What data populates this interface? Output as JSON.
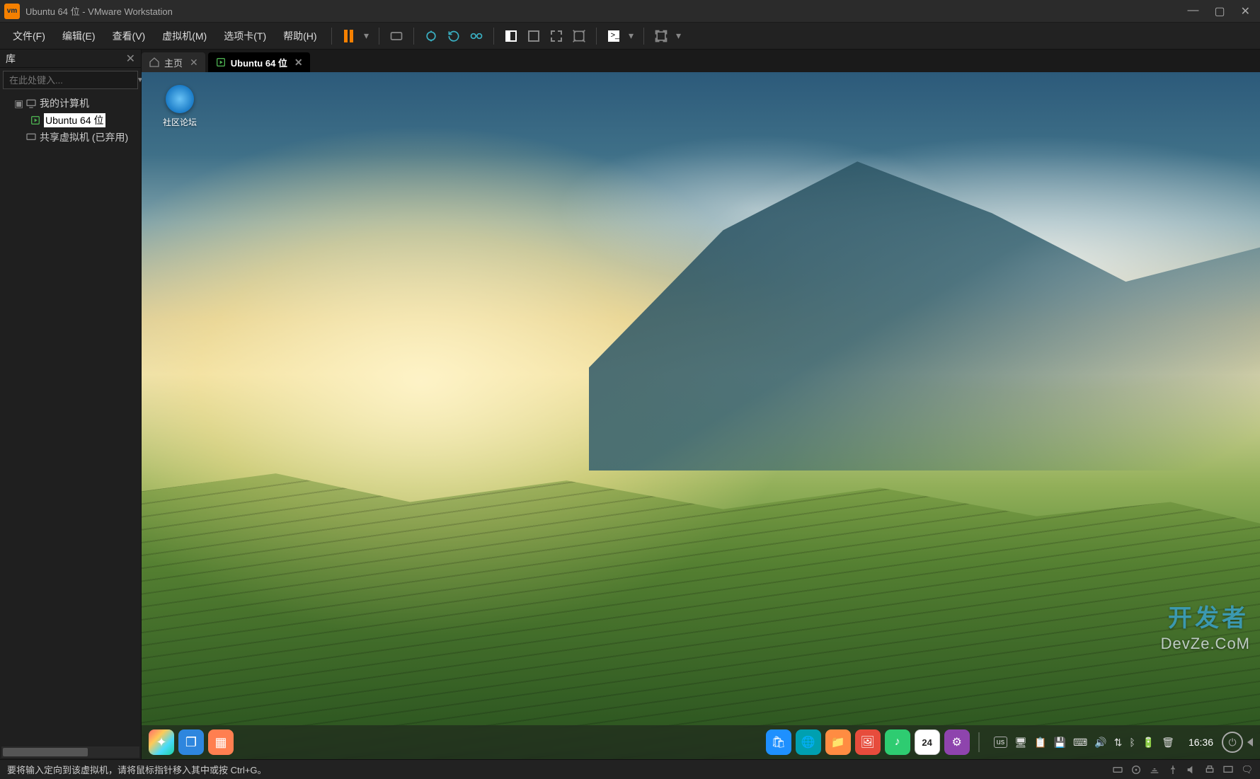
{
  "titlebar": {
    "title": "Ubuntu 64 位 - VMware Workstation"
  },
  "menu": {
    "file": "文件(F)",
    "edit": "编辑(E)",
    "view": "查看(V)",
    "vm": "虚拟机(M)",
    "tabs": "选项卡(T)",
    "help": "帮助(H)"
  },
  "sidebar": {
    "title": "库",
    "search_placeholder": "在此处键入...",
    "tree": {
      "root": "我的计算机",
      "vm1": "Ubuntu 64 位",
      "shared": "共享虚拟机 (已弃用)"
    }
  },
  "tabs": {
    "home": "主页",
    "vm": "Ubuntu 64 位"
  },
  "desktop": {
    "forum_icon": "社区论坛"
  },
  "dock": {
    "calendar_day": "24",
    "ime": "us",
    "clock": "16:36"
  },
  "statusbar": {
    "hint": "要将输入定向到该虚拟机，请将鼠标指针移入其中或按 Ctrl+G。"
  },
  "watermark": {
    "cn": "开发者",
    "en": "DevZe.CoM"
  }
}
